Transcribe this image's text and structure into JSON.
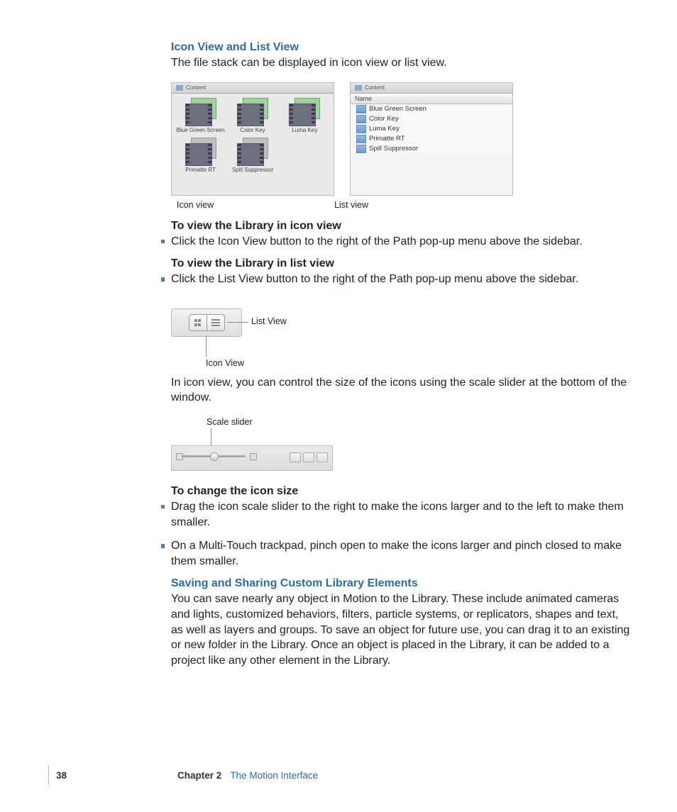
{
  "section1": {
    "heading": "Icon View and List View",
    "intro": "The file stack can be displayed in icon view or list view."
  },
  "screenshots": {
    "content_label": "Content",
    "name_column": "Name",
    "items": [
      "Blue Green Screen",
      "Color Key",
      "Luma Key",
      "Primatte RT",
      "Spill Suppressor"
    ],
    "icon_view_caption": "Icon view",
    "list_view_caption": "List view"
  },
  "iconview": {
    "heading": "To view the Library in icon view",
    "bullet": "Click the Icon View button to the right of the Path pop-up menu above the sidebar."
  },
  "listview": {
    "heading": "To view the Library in list view",
    "bullet": "Click the List View button to the right of the Path pop-up menu above the sidebar."
  },
  "buttons_callout": {
    "list_label": "List View",
    "icon_label": "Icon View"
  },
  "scale_intro": "In icon view, you can control the size of the icons using the scale slider at the bottom of the window.",
  "slider": {
    "label": "Scale slider"
  },
  "iconsize": {
    "heading": "To change the icon size",
    "bullet1": "Drag the icon scale slider to the right to make the icons larger and to the left to make them smaller.",
    "bullet2": "On a Multi-Touch trackpad, pinch open to make the icons larger and pinch closed to make them smaller."
  },
  "section2": {
    "heading": "Saving and Sharing Custom Library Elements",
    "body": "You can save nearly any object in Motion to the Library. These include animated cameras and lights, customized behaviors, filters, particle systems, or replicators, shapes and text, as well as layers and groups. To save an object for future use, you can drag it to an existing or new folder in the Library. Once an object is placed in the Library, it can be added to a project like any other element in the Library."
  },
  "footer": {
    "page": "38",
    "chapter": "Chapter 2",
    "title": "The Motion Interface"
  }
}
